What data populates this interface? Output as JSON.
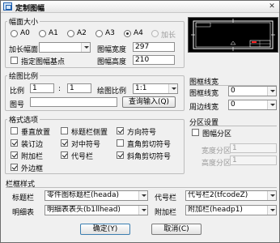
{
  "window": {
    "title": "定制图幅"
  },
  "paper_size": {
    "title": "幅面大小",
    "options": [
      {
        "label": "A0",
        "checked": false,
        "disabled": false
      },
      {
        "label": "A1",
        "checked": false,
        "disabled": false
      },
      {
        "label": "A2",
        "checked": false,
        "disabled": false
      },
      {
        "label": "A3",
        "checked": false,
        "disabled": false
      },
      {
        "label": "A4",
        "checked": true,
        "disabled": false
      },
      {
        "label": "加长",
        "checked": false,
        "disabled": true
      }
    ],
    "extend_label": "加长幅面",
    "extend_value": "",
    "custom_base_label": "指定图幅基点",
    "custom_base_checked": false,
    "width_label": "图幅宽度",
    "width_value": "297",
    "height_label": "图幅高度",
    "height_value": "210"
  },
  "scale": {
    "title": "绘图比例",
    "ratio_label": "比例",
    "ratio_left": "1",
    "ratio_sep": ":",
    "ratio_right": "1",
    "draw_scale_label": "绘图比例",
    "draw_scale_value": "1:1",
    "drawing_no_label": "图号",
    "drawing_no_value": "",
    "query_button": "查询输入(Q)"
  },
  "frame_line": {
    "title": "图框线宽",
    "line_width_label": "图框线宽",
    "line_width_value": "0",
    "border_width_label": "周边线宽",
    "border_width_value": "0"
  },
  "format": {
    "title": "格式选项",
    "items": [
      {
        "label": "垂直放置",
        "checked": false
      },
      {
        "label": "标题栏侧置",
        "checked": false
      },
      {
        "label": "方向符号",
        "checked": true
      },
      {
        "label": "装订边",
        "checked": true
      },
      {
        "label": "对中符号",
        "checked": true
      },
      {
        "label": "直角剪切符号",
        "checked": false
      },
      {
        "label": "附加栏",
        "checked": true
      },
      {
        "label": "代号栏",
        "checked": true
      },
      {
        "label": "斜角剪切符号",
        "checked": true
      },
      {
        "label": "外边框",
        "checked": true
      }
    ]
  },
  "zone": {
    "title": "分区设置",
    "enable_label": "图幅分区",
    "enable_checked": false,
    "width_label": "宽度分区",
    "width_value": "1",
    "height_label": "高度分区",
    "height_value": "1"
  },
  "frame_style": {
    "title": "栏框样式",
    "title_block_label": "标题栏",
    "title_block_value": "零件图标题栏(heada)",
    "code_label": "代号栏",
    "code_value": "代号栏2(tfcodeZ)",
    "detail_label": "明细表",
    "detail_value": "明细表表头(b1llhead)",
    "extra_label": "附加栏",
    "extra_value": "附加栏(headp1)"
  },
  "buttons": {
    "ok": "确定(Y)",
    "cancel": "取消(C)"
  },
  "colors": {
    "preview_bg": "#000000",
    "preview_frame": "#ffffff",
    "preview_accent": "#ff2020",
    "window_bg": "#f0f0f0"
  }
}
